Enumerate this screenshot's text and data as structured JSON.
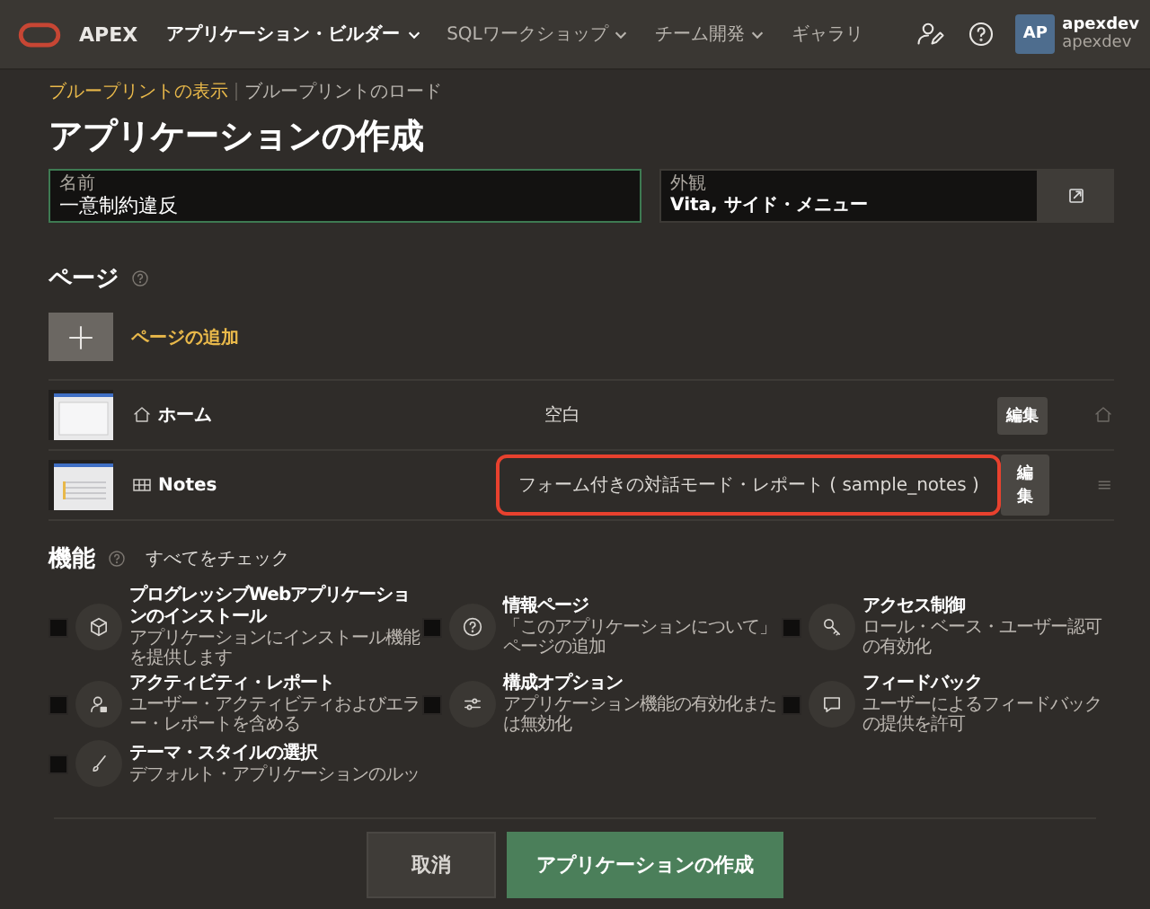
{
  "header": {
    "product": "APEX",
    "nav": [
      {
        "label": "アプリケーション・ビルダー",
        "selected": true,
        "caret": true
      },
      {
        "label": "SQLワークショップ",
        "selected": false,
        "caret": true
      },
      {
        "label": "チーム開発",
        "selected": false,
        "caret": true
      },
      {
        "label": "ギャラリ",
        "selected": false,
        "caret": false
      }
    ],
    "avatar": "AP",
    "user": "apexdev",
    "workspace": "apexdev"
  },
  "breadcrumbs": [
    {
      "label": "ブループリントの表示",
      "selected": true
    },
    {
      "label": "ブループリントのロード",
      "selected": false
    }
  ],
  "title": "アプリケーションの作成",
  "name_field": {
    "label": "名前",
    "value": "一意制約違反"
  },
  "appearance_field": {
    "label": "外観",
    "value": "Vita, サイド・メニュー"
  },
  "pages": {
    "heading": "ページ",
    "add_label": "ページの追加",
    "rows": [
      {
        "kind": "home",
        "name": "ホーム",
        "type": "空白",
        "highlighted": false,
        "edit": "編集"
      },
      {
        "kind": "report",
        "name": "Notes",
        "type": "フォーム付きの対話モード・レポート ( sample_notes )",
        "highlighted": true,
        "edit": "編集"
      }
    ]
  },
  "features": {
    "heading": "機能",
    "check_all": "すべてをチェック",
    "items": [
      {
        "kind": "cube",
        "title": "プログレッシブWebアプリケーションのインストール",
        "description": "アプリケーションにインストール機能を提供します",
        "checked": false
      },
      {
        "kind": "question",
        "title": "情報ページ",
        "description": "「このアプリケーションについて」ページの追加",
        "checked": false
      },
      {
        "kind": "key",
        "title": "アクセス制御",
        "description": "ロール・ベース・ユーザー認可の有効化",
        "checked": false
      },
      {
        "kind": "user",
        "title": "アクティビティ・レポート",
        "description": "ユーザー・アクティビティおよびエラー・レポートを含める",
        "checked": false
      },
      {
        "kind": "sliders",
        "title": "構成オプション",
        "description": "アプリケーション機能の有効化または無効化",
        "checked": false
      },
      {
        "kind": "chat",
        "title": "フィードバック",
        "description": "ユーザーによるフィードバックの提供を許可",
        "checked": false
      },
      {
        "kind": "brush",
        "title": "テーマ・スタイルの選択",
        "description": "デフォルト・アプリケーションのルッ",
        "checked": false
      }
    ]
  },
  "footer": {
    "cancel": "取消",
    "create": "アプリケーションの作成"
  }
}
